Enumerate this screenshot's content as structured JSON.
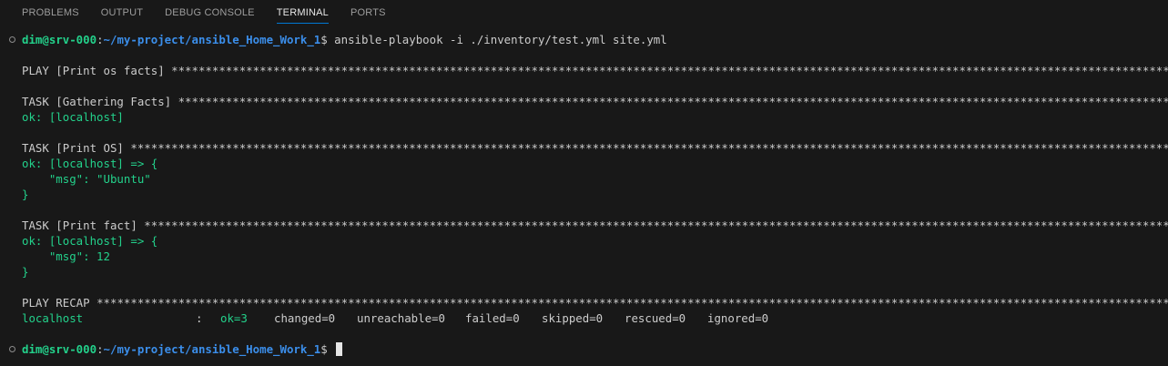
{
  "tabs": [
    "PROBLEMS",
    "OUTPUT",
    "DEBUG CONSOLE",
    "TERMINAL",
    "PORTS"
  ],
  "active_tab": "TERMINAL",
  "prompt": {
    "user": "dim@srv-000",
    "sep": ":",
    "path": "~/my-project/ansible_Home_Work_1",
    "symbol": "$ "
  },
  "command": "ansible-playbook -i ./inventory/test.yml site.yml",
  "stars": "*******************************************************************************************************************************************************************************************************************************",
  "output": {
    "play_header": "PLAY [Print os facts] ",
    "task1_header": "TASK [Gathering Facts] ",
    "task1_ok": "ok: [localhost]",
    "task2_header": "TASK [Print OS] ",
    "task2_ok": "ok: [localhost] => {",
    "task2_msg": "    \"msg\": \"Ubuntu\"",
    "task2_close": "}",
    "task3_header": "TASK [Print fact] ",
    "task3_ok": "ok: [localhost] => {",
    "task3_msg": "    \"msg\": 12",
    "task3_close": "}",
    "recap_header": "PLAY RECAP "
  },
  "recap": {
    "host": "localhost",
    "colon": ":",
    "ok": "ok=3",
    "changed": "changed=0",
    "unreachable": "unreachable=0",
    "failed": "failed=0",
    "skipped": "skipped=0",
    "rescued": "rescued=0",
    "ignored": "ignored=0"
  },
  "colors": {
    "background": "#181818",
    "tab_active_border": "#0078d4",
    "ok_green": "#23d18b",
    "path_blue": "#3b8eea",
    "text": "#cccccc"
  }
}
